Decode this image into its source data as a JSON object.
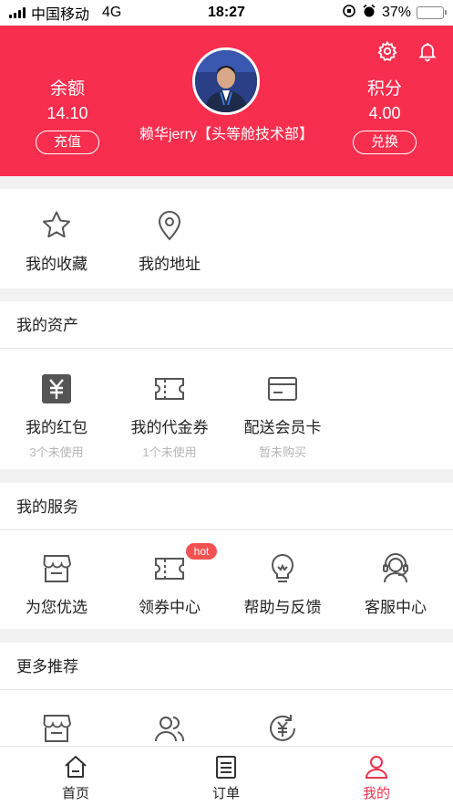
{
  "status_bar": {
    "carrier": "中国移动",
    "network": "4G",
    "time": "18:27",
    "battery": "37%",
    "battery_level": 0.37
  },
  "header": {
    "balance": {
      "label": "余额",
      "value": "14.10",
      "button": "充值"
    },
    "points": {
      "label": "积分",
      "value": "4.00",
      "button": "兑换"
    },
    "username": "赖华jerry【头等舱技术部】",
    "icons": [
      "settings-icon",
      "bell-icon"
    ]
  },
  "quick": {
    "items": [
      {
        "label": "我的收藏",
        "icon": "star-icon"
      },
      {
        "label": "我的地址",
        "icon": "location-icon"
      }
    ]
  },
  "assets": {
    "title": "我的资产",
    "items": [
      {
        "label": "我的红包",
        "sub": "3个未使用",
        "icon": "red-packet-icon"
      },
      {
        "label": "我的代金券",
        "sub": "1个未使用",
        "icon": "voucher-icon"
      },
      {
        "label": "配送会员卡",
        "sub": "暂未购买",
        "icon": "card-icon"
      }
    ]
  },
  "services": {
    "title": "我的服务",
    "badge": "hot",
    "items": [
      {
        "label": "为您优选",
        "icon": "store-icon"
      },
      {
        "label": "领券中心",
        "icon": "coupon-icon"
      },
      {
        "label": "帮助与反馈",
        "icon": "lightbulb-icon"
      },
      {
        "label": "客服中心",
        "icon": "headset-icon"
      }
    ]
  },
  "more": {
    "title": "更多推荐",
    "items": [
      {
        "icon": "store-icon"
      },
      {
        "icon": "users-icon"
      },
      {
        "icon": "yuan-refresh-icon"
      }
    ]
  },
  "tabbar": {
    "tabs": [
      {
        "label": "首页",
        "icon": "home-icon"
      },
      {
        "label": "订单",
        "icon": "order-list-icon"
      },
      {
        "label": "我的",
        "icon": "user-icon",
        "active": true
      }
    ]
  },
  "colors": {
    "primary": "#f72e4e",
    "hot_badge": "#f25252",
    "muted_text": "#b5b5b5",
    "icon_gray": "#555555"
  }
}
